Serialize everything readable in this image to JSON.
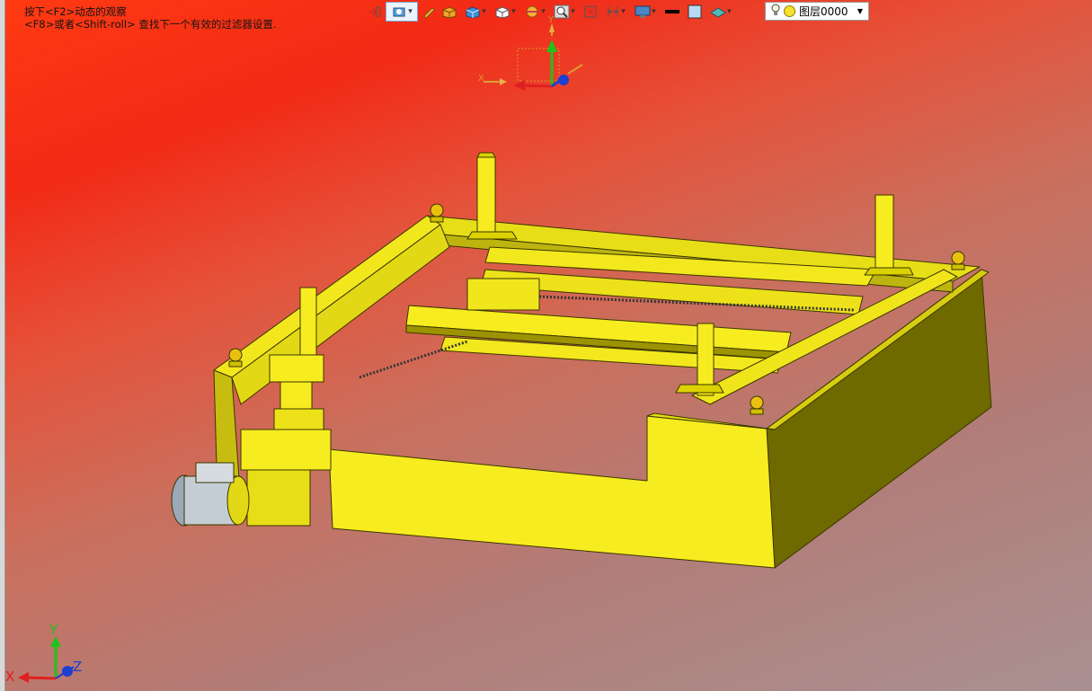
{
  "hint": {
    "line1": "按下<F2>动态的观察",
    "line2": "<F8>或者<Shift-roll> 查找下一个有效的过滤器设置."
  },
  "toolbar": {
    "icons": [
      "pick-filter-icon",
      "view-rotate-icon",
      "sketch-pencil-icon",
      "shaded-box-icon",
      "solid-box-icon",
      "cube-view-icon",
      "section-view-icon",
      "zoom-icon",
      "fit-view-icon",
      "dimension-icon",
      "display-settings-icon",
      "line-color-icon",
      "fill-color-icon",
      "material-icon"
    ],
    "layer": {
      "label": "图层0000"
    }
  },
  "triad_top": {
    "x": "X",
    "y": "Y"
  },
  "triad_bottom": {
    "x": "X",
    "y": "Y",
    "z": "Z"
  },
  "colors": {
    "model": "#f7ec1f",
    "model_dark": "#6f6a00",
    "bg_top": "#ff3a12",
    "bg_bottom": "#a99091"
  }
}
